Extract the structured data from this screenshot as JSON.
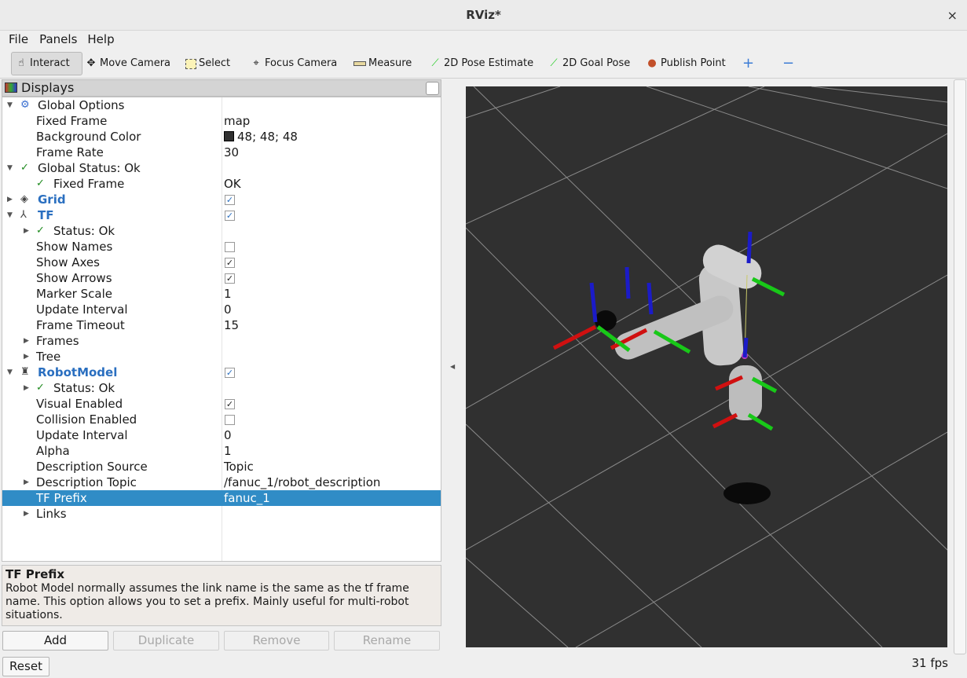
{
  "window": {
    "title": "RViz*",
    "close": "×"
  },
  "menu": [
    "File",
    "Panels",
    "Help"
  ],
  "toolbar": {
    "interact": "Interact",
    "move_camera": "Move Camera",
    "select": "Select",
    "focus_camera": "Focus Camera",
    "measure": "Measure",
    "pose_estimate": "2D Pose Estimate",
    "goal_pose": "2D Goal Pose",
    "publish_point": "Publish Point",
    "add_icon": "+",
    "remove_icon": "−"
  },
  "displays": {
    "title": "Displays",
    "rows": [
      {
        "label": "Global Options",
        "level": 0,
        "expander": "open",
        "icon": "gear",
        "iconchar": "⚙"
      },
      {
        "label": "Fixed Frame",
        "level": 1,
        "value": "map"
      },
      {
        "label": "Background Color",
        "level": 1,
        "value": "48; 48; 48",
        "swatch": "#303030"
      },
      {
        "label": "Frame Rate",
        "level": 1,
        "value": "30"
      },
      {
        "label": "Global Status: Ok",
        "level": 0,
        "expander": "open",
        "icon": "check",
        "iconchar": "✓"
      },
      {
        "label": "Fixed Frame",
        "level": 1,
        "value": "OK",
        "icon": "check",
        "iconchar": "✓"
      },
      {
        "label": "Grid",
        "level": 0,
        "expander": "closed",
        "icon": "grid",
        "iconchar": "◈",
        "bold": true,
        "checked": true
      },
      {
        "label": "TF",
        "level": 0,
        "expander": "open",
        "icon": "axes",
        "iconchar": "⅄",
        "bold": true,
        "checked": true
      },
      {
        "label": "Status: Ok",
        "level": 1,
        "expander": "closed",
        "icon": "check",
        "iconchar": "✓"
      },
      {
        "label": "Show Names",
        "level": 1,
        "checked": false
      },
      {
        "label": "Show Axes",
        "level": 1,
        "checked": true
      },
      {
        "label": "Show Arrows",
        "level": 1,
        "checked": true
      },
      {
        "label": "Marker Scale",
        "level": 1,
        "value": "1"
      },
      {
        "label": "Update Interval",
        "level": 1,
        "value": "0"
      },
      {
        "label": "Frame Timeout",
        "level": 1,
        "value": "15"
      },
      {
        "label": "Frames",
        "level": 1,
        "expander": "closed"
      },
      {
        "label": "Tree",
        "level": 1,
        "expander": "closed"
      },
      {
        "label": "RobotModel",
        "level": 0,
        "expander": "open",
        "icon": "robot",
        "iconchar": "♜",
        "bold": true,
        "checked": true
      },
      {
        "label": "Status: Ok",
        "level": 1,
        "expander": "closed",
        "icon": "check",
        "iconchar": "✓"
      },
      {
        "label": "Visual Enabled",
        "level": 1,
        "checked": true
      },
      {
        "label": "Collision Enabled",
        "level": 1,
        "checked": false
      },
      {
        "label": "Update Interval",
        "level": 1,
        "value": "0"
      },
      {
        "label": "Alpha",
        "level": 1,
        "value": "1"
      },
      {
        "label": "Description Source",
        "level": 1,
        "value": "Topic"
      },
      {
        "label": "Description Topic",
        "level": 1,
        "expander": "closed",
        "value": "/fanuc_1/robot_description"
      },
      {
        "label": "TF Prefix",
        "level": 1,
        "value": "fanuc_1",
        "selected": true
      },
      {
        "label": "Links",
        "level": 1,
        "expander": "closed"
      }
    ]
  },
  "description": {
    "title": "TF Prefix",
    "text": "Robot Model normally assumes the link name is the same as the tf frame name. This option allows you to set a prefix. Mainly useful for multi-robot situations."
  },
  "buttons": {
    "add": "Add",
    "duplicate": "Duplicate",
    "remove": "Remove",
    "rename": "Rename",
    "reset": "Reset"
  },
  "view": {
    "background": "#303030",
    "fps": "31 fps"
  }
}
